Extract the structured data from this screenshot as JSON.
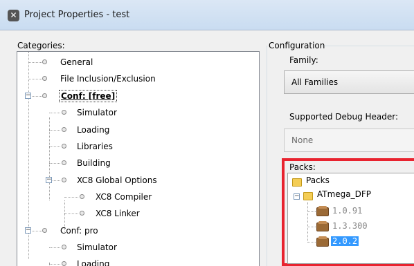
{
  "window": {
    "title": "Project Properties - test",
    "icon": "app-logo-icon"
  },
  "categories": {
    "label": "Categories:",
    "items": [
      {
        "label": "General",
        "level": 1,
        "expander": null,
        "selected": false
      },
      {
        "label": "File Inclusion/Exclusion",
        "level": 1,
        "expander": null,
        "selected": false
      },
      {
        "label": "Conf: [free]",
        "level": 1,
        "expander": "minus",
        "selected": true
      },
      {
        "label": "Simulator",
        "level": 2,
        "expander": null,
        "selected": false
      },
      {
        "label": "Loading",
        "level": 2,
        "expander": null,
        "selected": false
      },
      {
        "label": "Libraries",
        "level": 2,
        "expander": null,
        "selected": false
      },
      {
        "label": "Building",
        "level": 2,
        "expander": null,
        "selected": false
      },
      {
        "label": "XC8 Global Options",
        "level": 2,
        "expander": "minus",
        "selected": false
      },
      {
        "label": "XC8 Compiler",
        "level": 3,
        "expander": null,
        "selected": false
      },
      {
        "label": "XC8 Linker",
        "level": 3,
        "expander": null,
        "selected": false
      },
      {
        "label": "Conf: pro",
        "level": 1,
        "expander": "minus",
        "selected": false
      },
      {
        "label": "Simulator",
        "level": 2,
        "expander": null,
        "selected": false
      },
      {
        "label": "Loading",
        "level": 2,
        "expander": null,
        "selected": false
      }
    ]
  },
  "configuration": {
    "group_label": "Configuration",
    "family_label": "Family:",
    "family_value": "All Families",
    "debug_header_label": "Supported Debug Header:",
    "debug_header_value": "None",
    "packs": {
      "label": "Packs:",
      "root": "Packs",
      "pack_name": "ATmega_DFP",
      "versions": [
        {
          "label": "1.0.91",
          "state": "dim"
        },
        {
          "label": "1.3.300",
          "state": "dim"
        },
        {
          "label": "2.0.2",
          "state": "selected"
        }
      ]
    }
  },
  "colors": {
    "highlight_border": "#e8232f",
    "selection": "#3399ff"
  }
}
